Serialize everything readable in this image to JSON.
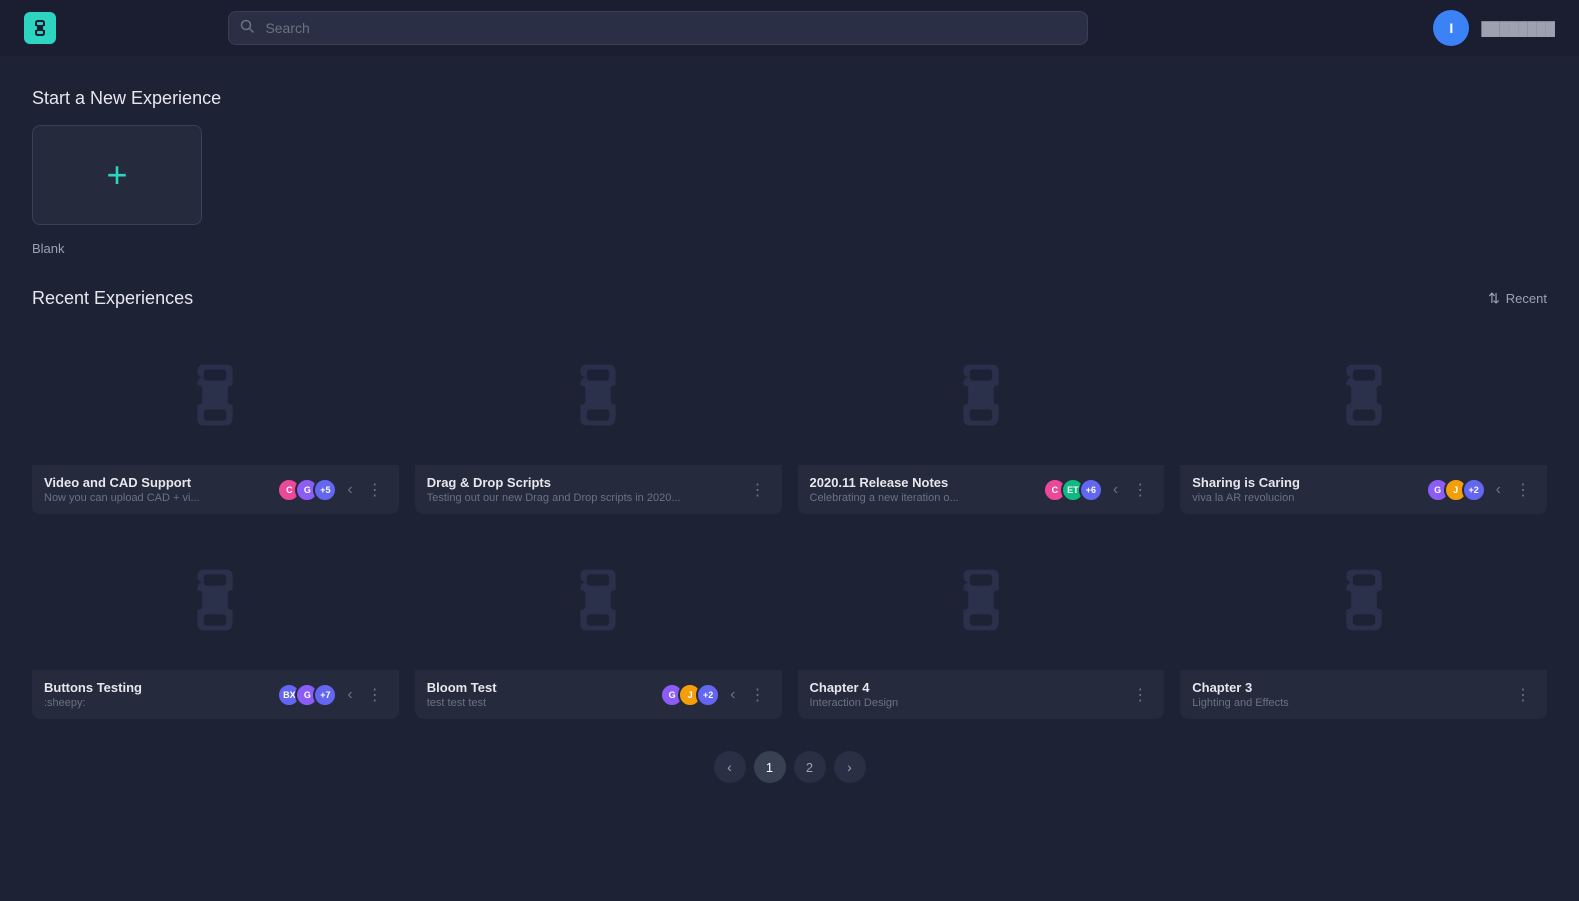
{
  "header": {
    "logo_letter": "E",
    "search_placeholder": "Search",
    "user_initial": "I",
    "user_name": "████████"
  },
  "new_experience": {
    "section_title": "Start a New Experience",
    "card_label": "Blank",
    "plus_symbol": "+"
  },
  "recent": {
    "section_title": "Recent Experiences",
    "sort_label": "Recent",
    "cards": [
      {
        "title": "Video and CAD Support",
        "subtitle": "Now you can upload CAD + vi...",
        "avatars": [
          {
            "letter": "C",
            "color": "#ec4899"
          },
          {
            "letter": "G",
            "color": "#8b5cf6"
          },
          {
            "letter": "+5",
            "color": "#6366f1"
          }
        ],
        "has_chevron": true
      },
      {
        "title": "Drag & Drop Scripts",
        "subtitle": "Testing out our new Drag and Drop scripts in 2020...",
        "avatars": [],
        "has_chevron": false
      },
      {
        "title": "2020.11 Release Notes",
        "subtitle": "Celebrating a new iteration o...",
        "avatars": [
          {
            "letter": "C",
            "color": "#ec4899"
          },
          {
            "letter": "ET",
            "color": "#10b981"
          },
          {
            "letter": "+6",
            "color": "#6366f1"
          }
        ],
        "has_chevron": true
      },
      {
        "title": "Sharing is Caring",
        "subtitle": "viva la AR revolucion",
        "avatars": [
          {
            "letter": "G",
            "color": "#8b5cf6"
          },
          {
            "letter": "J",
            "color": "#f59e0b"
          },
          {
            "letter": "+2",
            "color": "#6366f1"
          }
        ],
        "has_chevron": true
      },
      {
        "title": "Buttons Testing",
        "subtitle": ":sheepy:",
        "avatars": [
          {
            "letter": "BX",
            "color": "#6366f1"
          },
          {
            "letter": "G",
            "color": "#8b5cf6"
          },
          {
            "letter": "+7",
            "color": "#6366f1"
          }
        ],
        "has_chevron": true
      },
      {
        "title": "Bloom Test",
        "subtitle": "test test test",
        "avatars": [
          {
            "letter": "G",
            "color": "#8b5cf6"
          },
          {
            "letter": "J",
            "color": "#f59e0b"
          },
          {
            "letter": "+2",
            "color": "#6366f1"
          }
        ],
        "has_chevron": true
      },
      {
        "title": "Chapter 4",
        "subtitle": "Interaction Design",
        "avatars": [],
        "has_chevron": false
      },
      {
        "title": "Chapter 3",
        "subtitle": "Lighting and Effects",
        "avatars": [],
        "has_chevron": false
      }
    ]
  },
  "pagination": {
    "prev_label": "‹",
    "next_label": "›",
    "pages": [
      "1",
      "2"
    ],
    "active_page": "1"
  }
}
